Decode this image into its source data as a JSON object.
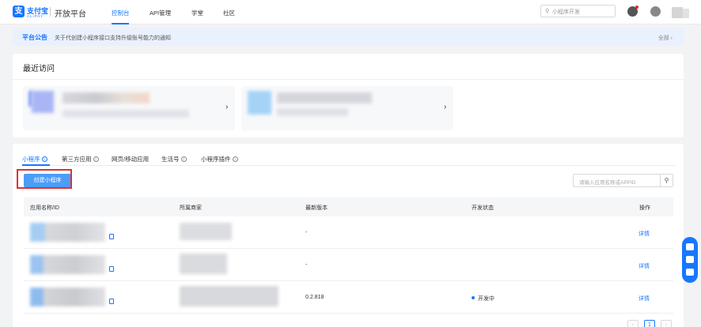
{
  "header": {
    "logo_cn": "支付宝",
    "logo_en": "ALIPAY",
    "platform": "开放平台",
    "nav": [
      "控制台",
      "API管理",
      "学堂",
      "社区"
    ],
    "search_placeholder": "小程序开发"
  },
  "notice": {
    "title": "平台公告",
    "text": "关于代创建小程序接口支持升级账号能力的通知",
    "all": "全部"
  },
  "recent": {
    "title": "最近访问"
  },
  "tabs": [
    "小程序",
    "第三方应用",
    "网页/移动应用",
    "生活号",
    "小程序插件"
  ],
  "create_button": "创建小程序",
  "app_search_placeholder": "请输入应用名称或APPID",
  "table": {
    "columns": [
      "应用名称/ID",
      "所属商家",
      "最新版本",
      "开发状态",
      "操作"
    ],
    "rows": [
      {
        "version": "-",
        "status": "",
        "action": "详情"
      },
      {
        "version": "-",
        "status": "",
        "action": "详情"
      },
      {
        "version": "0.2.818",
        "status": "开发中",
        "action": "详情"
      }
    ]
  },
  "pagination": {
    "current": "1"
  },
  "colors": {
    "accent": "#1677ff",
    "highlight_box": "#e03131"
  }
}
